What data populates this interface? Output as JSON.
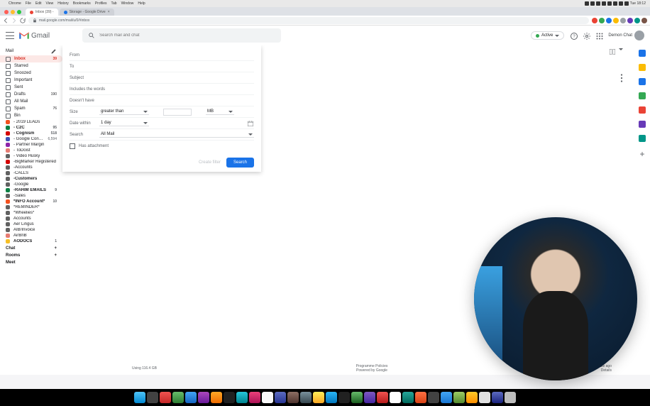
{
  "menubar": {
    "items": [
      "Chrome",
      "File",
      "Edit",
      "View",
      "History",
      "Bookmarks",
      "Profiles",
      "Tab",
      "Window",
      "Help"
    ],
    "time": "Tue 18:12"
  },
  "tabs": [
    {
      "title": "Inbox (39) - ",
      "active": true
    },
    {
      "title": "Storage - Google Drive",
      "active": false
    }
  ],
  "url": "mail.google.com/mail/u/0/#inbox",
  "brand": "Gmail",
  "search": {
    "placeholder": "Search mail and chat"
  },
  "header": {
    "active": "Active",
    "user": "Demon Chat"
  },
  "sidebar": {
    "mail_header": "Mail",
    "system": [
      {
        "name": "Inbox",
        "count": "39",
        "active": true
      },
      {
        "name": "Starred"
      },
      {
        "name": "Snoozed"
      },
      {
        "name": "Important"
      },
      {
        "name": "Sent"
      },
      {
        "name": "Drafts",
        "count": "190"
      },
      {
        "name": "All Mail"
      },
      {
        "name": "Spam",
        "count": "76"
      },
      {
        "name": "Bin"
      }
    ],
    "labels": [
      {
        "name": "- 2019 LEADs",
        "color": "#f4511e"
      },
      {
        "name": "- C2C",
        "count": "95",
        "color": "#0b8043",
        "bold": true
      },
      {
        "name": "- Cognism",
        "count": "518",
        "color": "#d50000",
        "bold": true
      },
      {
        "name": "- Google Connec...",
        "count": "6,594",
        "color": "#3f51b5"
      },
      {
        "name": "- Partner Margin",
        "color": "#8e24aa"
      },
      {
        "name": "- ToDoist",
        "color": "#e67c73"
      },
      {
        "name": "- Video Husky",
        "color": "#616161"
      },
      {
        "name": "-BigMarker Registered",
        "color": "#d50000"
      },
      {
        "name": "-Accounts",
        "color": "#616161"
      },
      {
        "name": "-CALLS",
        "color": "#616161"
      },
      {
        "name": "-Customers",
        "color": "#616161",
        "bold": true
      },
      {
        "name": "-Google",
        "color": "#616161"
      },
      {
        "name": "-RAHIM EMAILS",
        "count": "9",
        "color": "#0b8043",
        "bold": true
      },
      {
        "name": "-Sales",
        "color": "#616161"
      },
      {
        "name": "*INFO Account*",
        "count": "10",
        "color": "#f4511e",
        "bold": true
      },
      {
        "name": "*REMINDER*",
        "color": "#616161"
      },
      {
        "name": "*Wheelies*",
        "color": "#616161"
      },
      {
        "name": "Accounts",
        "color": "#616161"
      },
      {
        "name": "Aer Lingus",
        "color": "#616161"
      },
      {
        "name": "AIB/Invoice",
        "color": "#616161"
      },
      {
        "name": "AirBnB",
        "color": "#e67c73"
      },
      {
        "name": "AODOCS",
        "count": "1",
        "color": "#f6bf26",
        "bold": true
      }
    ],
    "chat": "Chat",
    "rooms": "Rooms",
    "meet": "Meet"
  },
  "advanced": {
    "from": "From",
    "to": "To",
    "subject": "Subject",
    "includes": "Includes the words",
    "doesnt": "Doesn't have",
    "size": "Size",
    "size_op": "greater than",
    "size_unit": "MB",
    "date_within": "Date within",
    "date_val": "1 day",
    "search_in": "Search",
    "search_val": "All Mail",
    "has_attachment": "Has attachment",
    "create_filter": "Create filter",
    "search_btn": "Search"
  },
  "footer": {
    "usage": "Using 116.4 GB",
    "policies": "Programme Policies",
    "powered": "Powered by Google",
    "activity": "Last account activity: 1 minute ago",
    "details": "Details"
  }
}
